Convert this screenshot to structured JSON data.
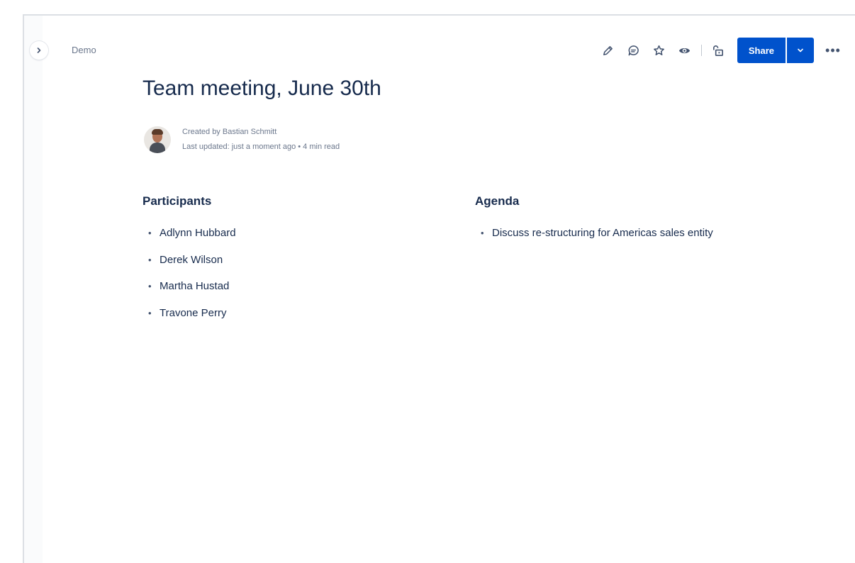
{
  "breadcrumb": {
    "space": "Demo"
  },
  "toolbar": {
    "icons": [
      "pencil-icon",
      "comment-icon",
      "star-icon",
      "eye-icon",
      "restrictions-icon"
    ],
    "share_label": "Share",
    "more_label": "•••"
  },
  "page": {
    "title": "Team meeting, June 30th",
    "byline": {
      "created_by": "Created by Bastian Schmitt",
      "last_updated": "Last updated: just a moment ago • 4 min read"
    }
  },
  "participants": {
    "heading": "Participants",
    "items": [
      "Adlynn Hubbard",
      "Derek Wilson",
      "Martha Hustad",
      "Travone Perry"
    ]
  },
  "agenda": {
    "heading": "Agenda",
    "items": [
      "Discuss re-structuring for Americas sales entity"
    ]
  },
  "colors": {
    "brand_blue": "#0052cc",
    "text_primary": "#172b4d",
    "text_subtle": "#6b778c"
  }
}
